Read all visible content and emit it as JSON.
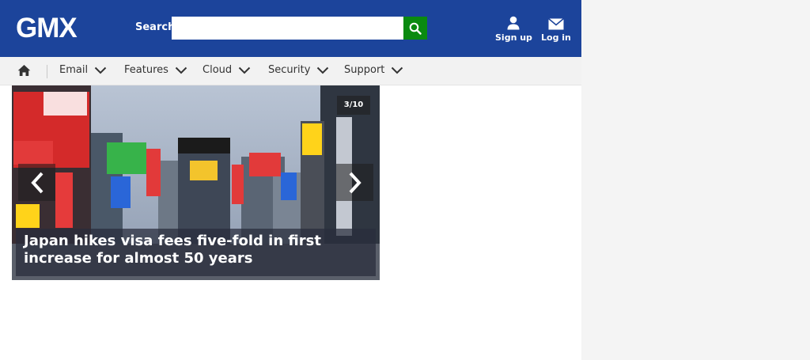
{
  "header": {
    "logo": "GMX",
    "search_label": "Search",
    "search_value": "",
    "search_placeholder": "",
    "signup_label": "Sign up",
    "login_label": "Log in",
    "brand_color": "#1c449b",
    "search_button_color": "#0a8a10"
  },
  "nav": {
    "items": [
      {
        "label": "Email"
      },
      {
        "label": "Features"
      },
      {
        "label": "Cloud"
      },
      {
        "label": "Security"
      },
      {
        "label": "Support"
      }
    ]
  },
  "slider": {
    "counter": "3/10",
    "headline": "Japan hikes visa fees five-fold in first increase for almost 50 years"
  },
  "icons": [
    "search-icon",
    "user-icon",
    "mail-icon",
    "home-icon",
    "chevron-down-icon",
    "chevron-left-icon",
    "chevron-right-icon"
  ]
}
